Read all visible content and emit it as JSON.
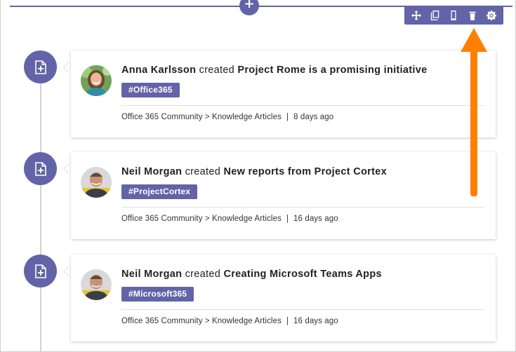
{
  "section": {
    "add_label": "+"
  },
  "toolbar": {
    "items": [
      {
        "name": "move-icon"
      },
      {
        "name": "duplicate-icon"
      },
      {
        "name": "mobile-view-icon"
      },
      {
        "name": "delete-icon"
      },
      {
        "name": "settings-icon"
      }
    ]
  },
  "feed": {
    "items": [
      {
        "author": "Anna Karlsson",
        "verb": "created",
        "title": "Project Rome is a promising initiative",
        "tag": "#Office365",
        "source": "Office 365 Community > Knowledge Articles",
        "separator": "|",
        "time": "8 days ago"
      },
      {
        "author": "Neil Morgan",
        "verb": "created",
        "title": "New reports from Project Cortex",
        "tag": "#ProjectCortex",
        "source": "Office 365 Community > Knowledge Articles",
        "separator": "|",
        "time": "16 days ago"
      },
      {
        "author": "Neil Morgan",
        "verb": "created",
        "title": "Creating Microsoft Teams Apps",
        "tag": "#Microsoft365",
        "source": "Office 365 Community > Knowledge Articles",
        "separator": "|",
        "time": "16 days ago"
      }
    ]
  },
  "colors": {
    "accent": "#6264a7",
    "annotation_arrow": "#ff8000"
  }
}
